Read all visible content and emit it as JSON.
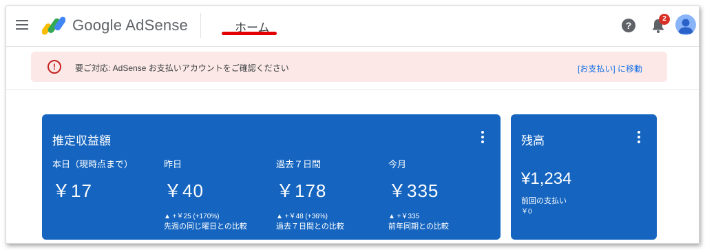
{
  "header": {
    "brand_google": "Google",
    "brand_product": "AdSense",
    "page_title": "ホーム",
    "notification_count": "2",
    "help_symbol": "?",
    "icons": [
      "menu-icon",
      "adsense-logo-icon",
      "help-icon",
      "bell-icon",
      "avatar-icon"
    ]
  },
  "alert": {
    "icon": "error-icon",
    "message": "要ご対応: AdSense お支払いアカウントをご確認ください",
    "action": "[お支払い] に移動",
    "color": "#c5221f"
  },
  "estimated_earnings": {
    "title": "推定収益額",
    "metrics": [
      {
        "label": "本日（現時点まで）",
        "value": "￥17",
        "delta": "",
        "compare": ""
      },
      {
        "label": "昨日",
        "value": "￥40",
        "delta": "▲ +￥25 (+170%)",
        "compare": "先週の同じ曜日との比較"
      },
      {
        "label": "過去７日間",
        "value": "￥178",
        "delta": "▲ +￥48 (+36%)",
        "compare": "過去７日間との比較"
      },
      {
        "label": "今月",
        "value": "￥335",
        "delta": "▲ +￥335",
        "compare": "前年同期との比較"
      }
    ]
  },
  "balance": {
    "title": "残高",
    "value": "¥1,234",
    "last_payment_label": "前回の支払い",
    "last_payment_value": "￥0"
  },
  "colors": {
    "card": "#1565c0",
    "alert_bg": "#fce8e6",
    "link": "#1a73e8",
    "badge": "#d93025",
    "underline": "#e30000"
  }
}
